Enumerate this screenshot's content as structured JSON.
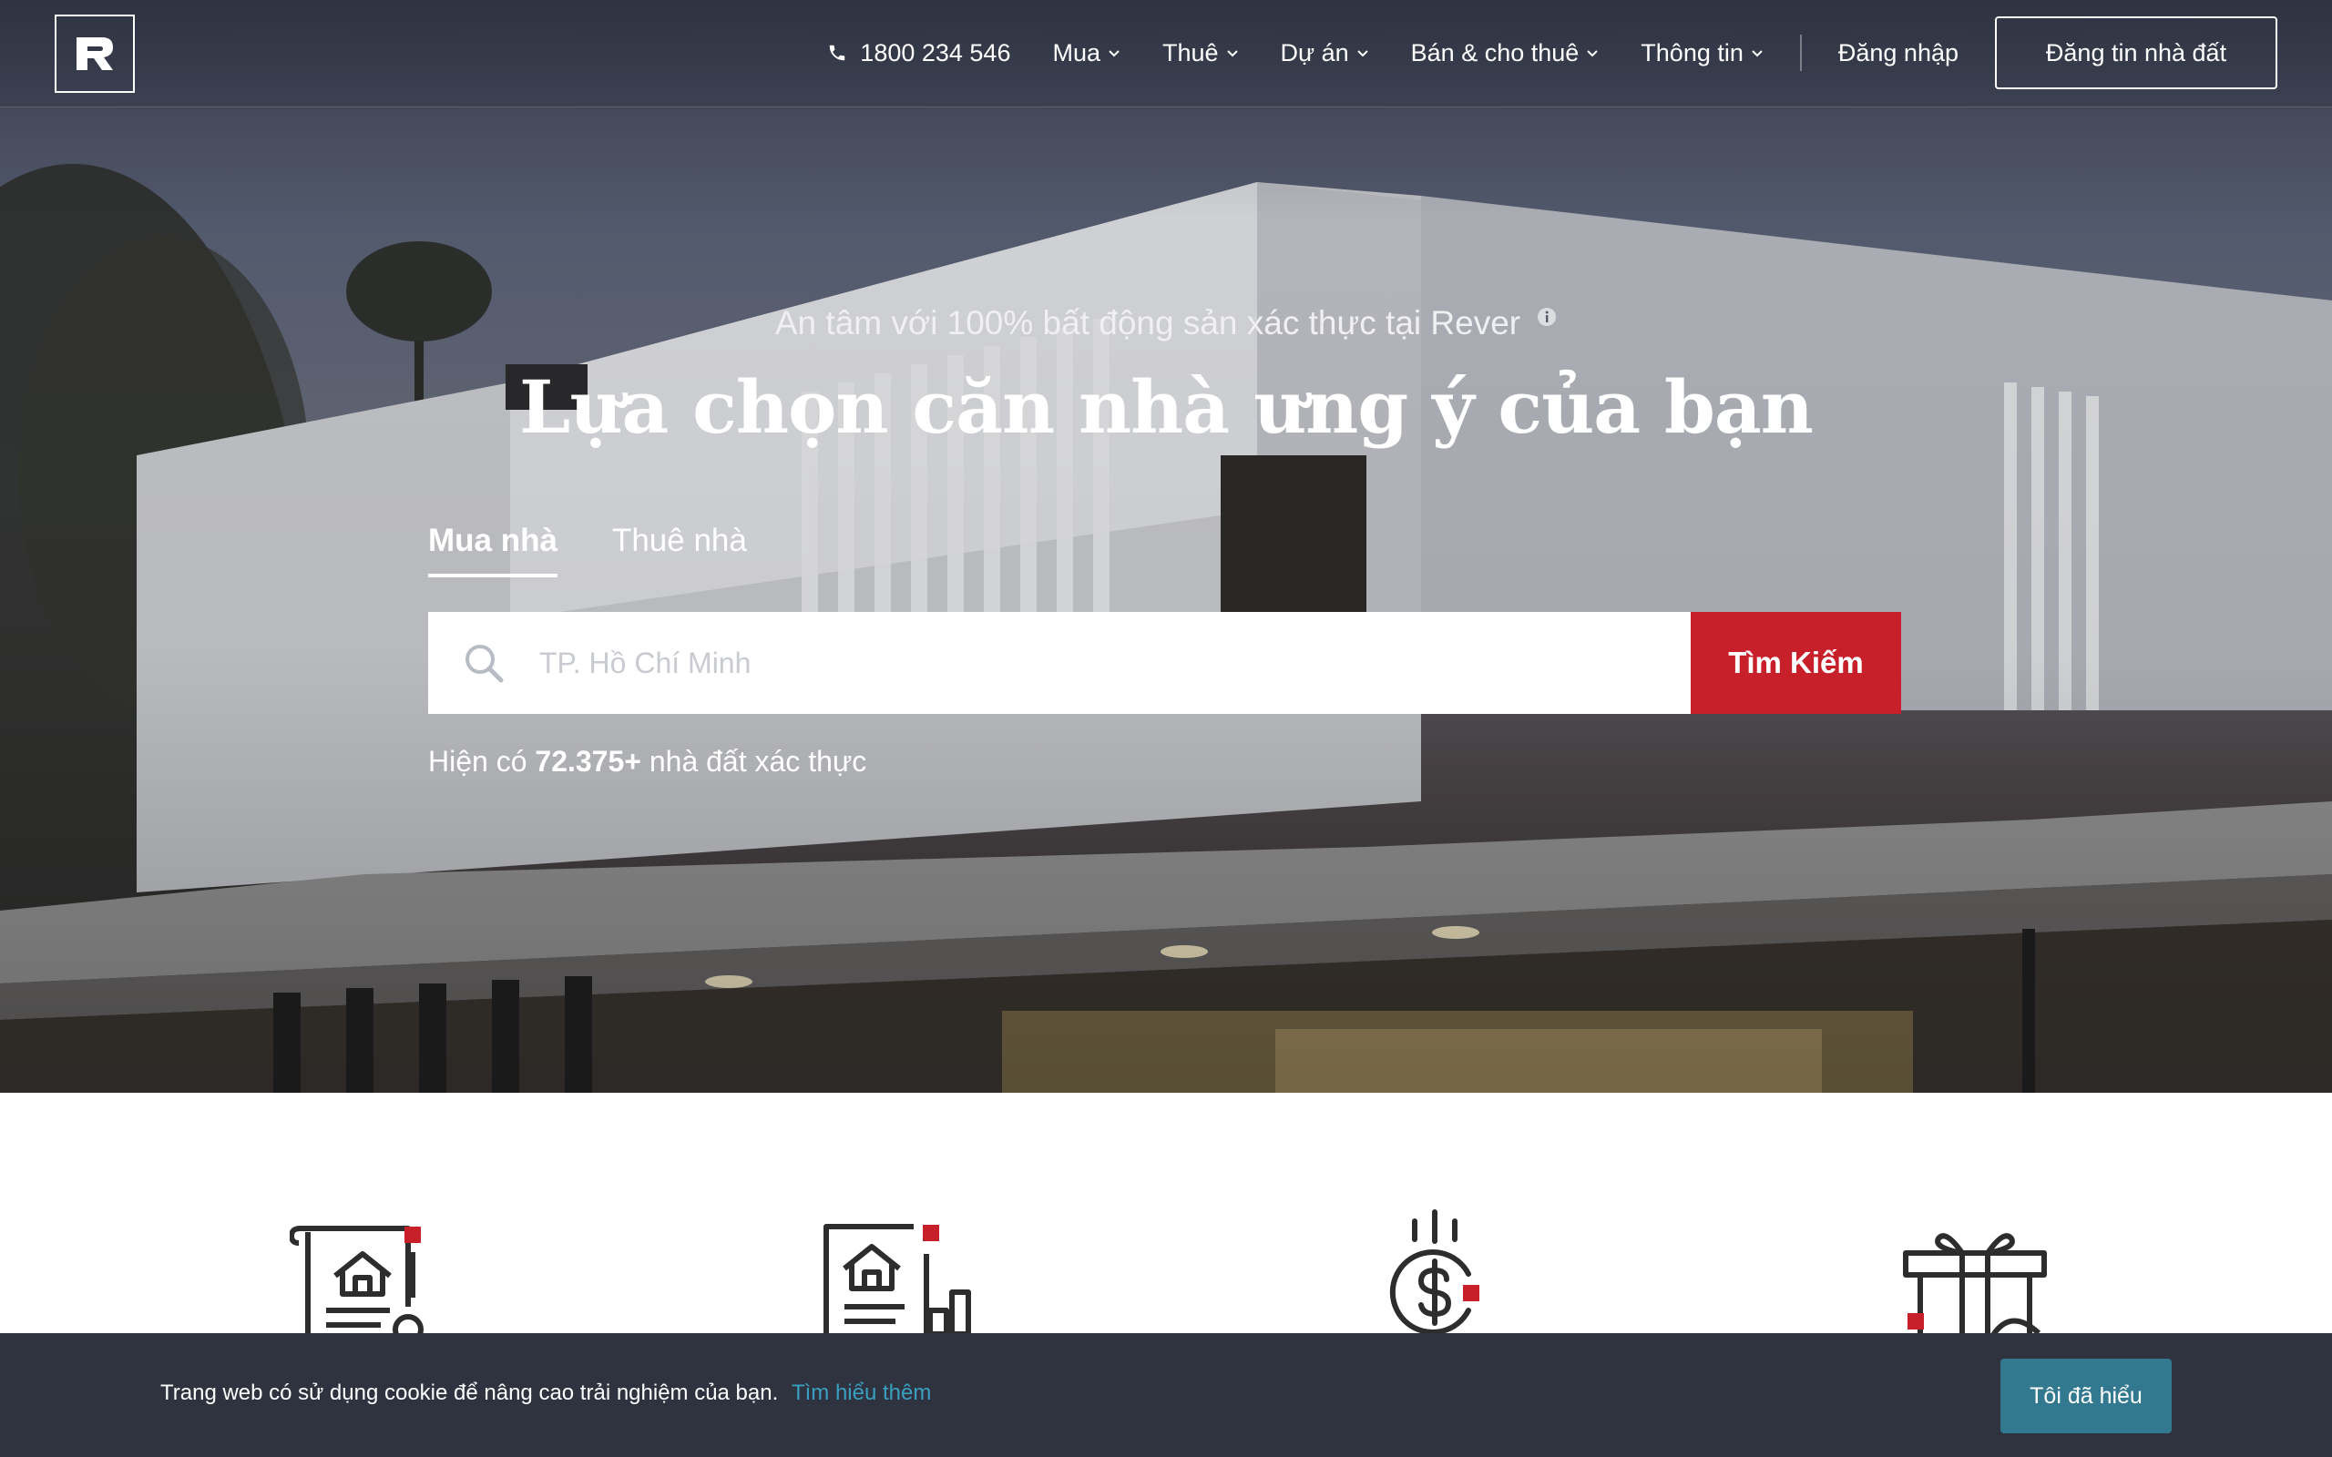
{
  "nav": {
    "logo_letter": "R",
    "phone": "1800 234 546",
    "items": [
      {
        "label": "Mua"
      },
      {
        "label": "Thuê"
      },
      {
        "label": "Dự án"
      },
      {
        "label": "Bán & cho thuê"
      },
      {
        "label": "Thông tin"
      }
    ],
    "login": "Đăng nhập",
    "post_button": "Đăng tin nhà đất"
  },
  "hero": {
    "tagline": "An tâm với 100% bất động sản xác thực tại Rever",
    "headline": "Lựa chọn căn nhà ưng ý của bạn",
    "tabs": [
      {
        "label": "Mua nhà",
        "active": true
      },
      {
        "label": "Thuê nhà",
        "active": false
      }
    ],
    "search": {
      "placeholder": "TP. Hồ Chí Minh",
      "button": "Tìm Kiếm"
    },
    "count": {
      "prefix": "Hiện có",
      "value": "72.375+",
      "suffix": "nhà đất xác thực"
    }
  },
  "features": [
    {
      "icon": "house-document-icon"
    },
    {
      "icon": "house-chart-icon"
    },
    {
      "icon": "dollar-coin-icon"
    },
    {
      "icon": "gift-icon"
    }
  ],
  "cookie": {
    "text": "Trang web có sử dụng cookie để nâng cao trải nghiệm của bạn.",
    "link": "Tìm hiểu thêm",
    "button": "Tôi đã hiểu"
  },
  "colors": {
    "accent_red": "#c8202a",
    "cookie_bg": "#2f3340",
    "cookie_button": "#32788e",
    "cookie_link": "#39a0bf"
  }
}
